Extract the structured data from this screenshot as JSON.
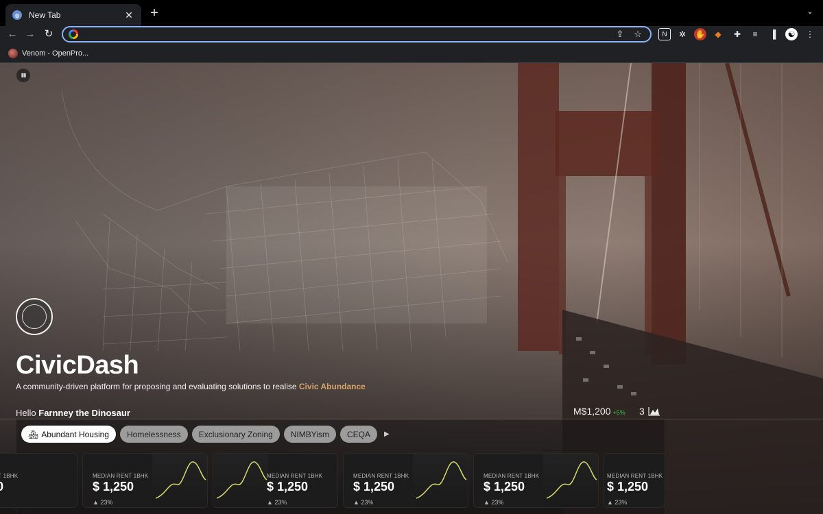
{
  "browser": {
    "tab_title": "New Tab",
    "tab_close": "✕",
    "new_tab": "+",
    "tab_search": "⌄",
    "omnibox_value": "",
    "bookmark_label": "Venom - OpenPro..."
  },
  "hero": {
    "title": "CivicDash",
    "subtitle": "A community-driven platform for proposing and evaluating solutions to realise ",
    "subtitle_accent": "Civic Abundance",
    "greeting_prefix": "Hello ",
    "user_name": "Farnney the Dinosaur"
  },
  "stats": {
    "balance": "M$1,200",
    "balance_delta": "+5%",
    "count": "3"
  },
  "tags": [
    {
      "label": "Abundant Housing",
      "active": true
    },
    {
      "label": "Homelessness"
    },
    {
      "label": "Exclusionary Zoning"
    },
    {
      "label": "NIMBYism"
    },
    {
      "label": "CEQA"
    }
  ],
  "tags_next": "▶",
  "cards": [
    {
      "label": "MEDIAN RENT 1BHK",
      "value": "$ 1,250",
      "change": "▲ 23%"
    },
    {
      "label": "MEDIAN RENT 1BHK",
      "value": "$ 1,250",
      "change": "▲ 23%"
    },
    {
      "label": "MEDIAN RENT 1BHK",
      "value": "$ 1,250",
      "change": "▲ 23%"
    },
    {
      "label": "MEDIAN RENT 1BHK",
      "value": "$ 1,250",
      "change": "▲ 23%"
    },
    {
      "label": "MEDIAN RENT 1BHK",
      "value": "$ 1,250",
      "change": "▲ 23%"
    }
  ],
  "colors": {
    "accent_blue": "#8ab4f8",
    "sparkline": "#d8dc6a",
    "positive": "#3fb950"
  },
  "icons": [
    "pause-icon",
    "city-seal",
    "share-icon",
    "star-icon",
    "extensions-icon"
  ]
}
